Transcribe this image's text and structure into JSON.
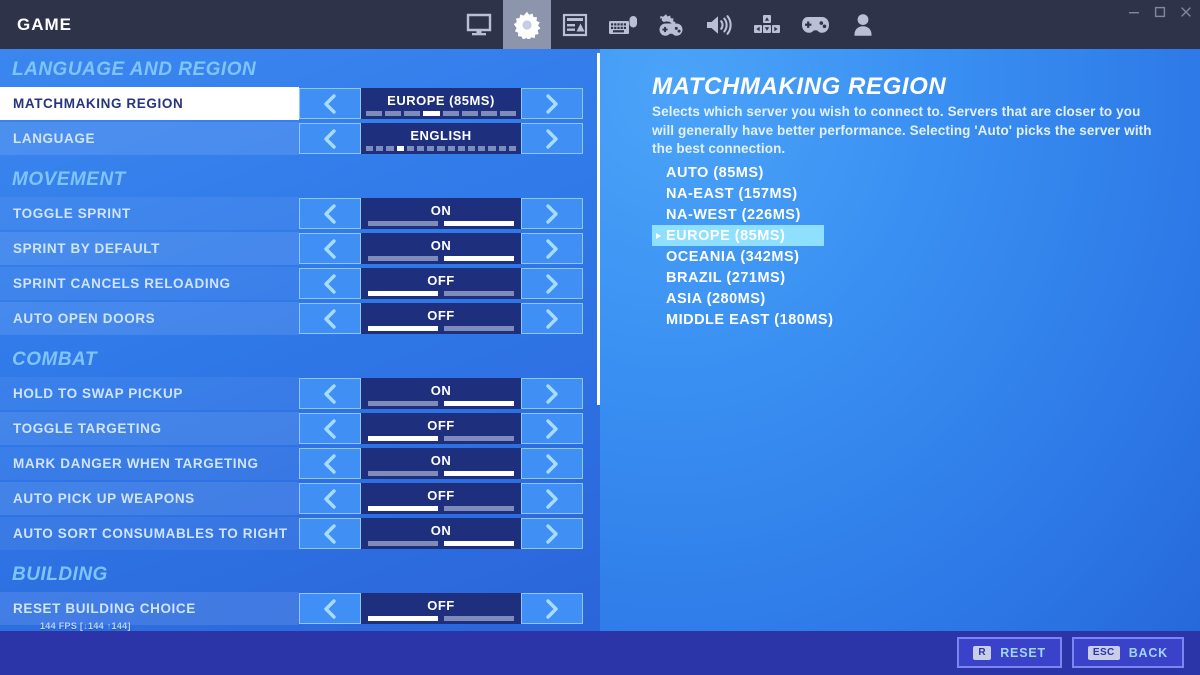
{
  "window": {
    "title": "GAME",
    "controls": [
      {
        "name": "minimize",
        "glyph": "minimize-icon"
      },
      {
        "name": "maximize",
        "glyph": "maximize-icon"
      },
      {
        "name": "close",
        "glyph": "close-icon"
      }
    ]
  },
  "tabs": [
    {
      "id": "video",
      "icon": "monitor-icon",
      "active": false
    },
    {
      "id": "game",
      "icon": "gear-icon",
      "active": true
    },
    {
      "id": "ui",
      "icon": "hud-layout-icon",
      "active": false
    },
    {
      "id": "input",
      "icon": "keyboard-mouse-icon",
      "active": false
    },
    {
      "id": "controller",
      "icon": "controller-config-icon",
      "active": false
    },
    {
      "id": "audio",
      "icon": "speaker-icon",
      "active": false
    },
    {
      "id": "movement",
      "icon": "dpad-keys-icon",
      "active": false
    },
    {
      "id": "gamepad",
      "icon": "gamepad-icon",
      "active": false
    },
    {
      "id": "account",
      "icon": "account-icon",
      "active": false
    }
  ],
  "settings": {
    "sections": [
      {
        "title": "LANGUAGE AND REGION",
        "rows": [
          {
            "label": "MATCHMAKING REGION",
            "value": "EUROPE (85MS)",
            "selected": true,
            "segments": 8,
            "active_segment": 4
          },
          {
            "label": "LANGUAGE",
            "value": "ENGLISH",
            "selected": false,
            "segments": 15,
            "active_segment": 4
          }
        ]
      },
      {
        "title": "MOVEMENT",
        "rows": [
          {
            "label": "TOGGLE SPRINT",
            "value": "ON",
            "selected": false,
            "segments": 2,
            "active_segment": 2
          },
          {
            "label": "SPRINT BY DEFAULT",
            "value": "ON",
            "selected": false,
            "segments": 2,
            "active_segment": 2
          },
          {
            "label": "SPRINT CANCELS RELOADING",
            "value": "OFF",
            "selected": false,
            "segments": 2,
            "active_segment": 1
          },
          {
            "label": "AUTO OPEN DOORS",
            "value": "OFF",
            "selected": false,
            "segments": 2,
            "active_segment": 1
          }
        ]
      },
      {
        "title": "COMBAT",
        "rows": [
          {
            "label": "HOLD TO SWAP PICKUP",
            "value": "ON",
            "selected": false,
            "segments": 2,
            "active_segment": 2
          },
          {
            "label": "TOGGLE TARGETING",
            "value": "OFF",
            "selected": false,
            "segments": 2,
            "active_segment": 1
          },
          {
            "label": "MARK DANGER WHEN TARGETING",
            "value": "ON",
            "selected": false,
            "segments": 2,
            "active_segment": 2
          },
          {
            "label": "AUTO PICK UP WEAPONS",
            "value": "OFF",
            "selected": false,
            "segments": 2,
            "active_segment": 1
          },
          {
            "label": "AUTO SORT CONSUMABLES TO RIGHT",
            "value": "ON",
            "selected": false,
            "segments": 2,
            "active_segment": 2
          }
        ]
      },
      {
        "title": "BUILDING",
        "rows": [
          {
            "label": "RESET BUILDING CHOICE",
            "value": "OFF",
            "selected": false,
            "segments": 2,
            "active_segment": 1
          }
        ]
      }
    ]
  },
  "overlay": {
    "fps_counter": "144 FPS [↓144 ↑144]"
  },
  "detail": {
    "title": "MATCHMAKING REGION",
    "description": "Selects which server you wish to connect to. Servers that are closer to you will generally have better performance. Selecting 'Auto' picks the server with the best connection.",
    "options": [
      {
        "label": "AUTO (85MS)",
        "selected": false
      },
      {
        "label": "NA-EAST (157MS)",
        "selected": false
      },
      {
        "label": "NA-WEST (226MS)",
        "selected": false
      },
      {
        "label": "EUROPE (85MS)",
        "selected": true
      },
      {
        "label": "OCEANIA (342MS)",
        "selected": false
      },
      {
        "label": "BRAZIL (271MS)",
        "selected": false
      },
      {
        "label": "ASIA (280MS)",
        "selected": false
      },
      {
        "label": "MIDDLE EAST (180MS)",
        "selected": false
      }
    ]
  },
  "footer": {
    "buttons": [
      {
        "key": "R",
        "label": "RESET"
      },
      {
        "key": "ESC",
        "label": "BACK"
      }
    ]
  },
  "colors": {
    "accent_cyan": "#8fe0ff",
    "titlebar": "#2f3349",
    "footer": "#2c35a8",
    "value_box": "#1e2f7e",
    "arrow_button": "#3f8ff5",
    "section_heading": "#7fc4ff"
  }
}
